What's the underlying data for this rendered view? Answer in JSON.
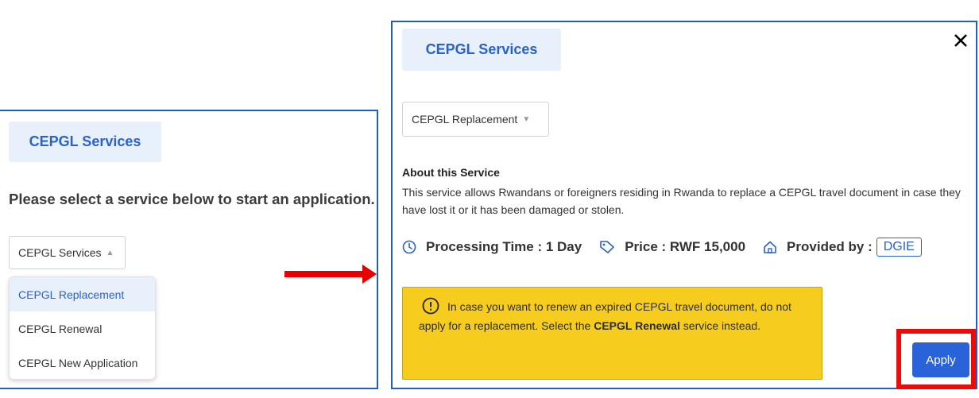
{
  "left_panel": {
    "tag": "CEPGL Services",
    "instruction": "Please select a service below to start an application.",
    "select_value": "CEPGL Services",
    "dropdown_options": [
      "CEPGL Replacement",
      "CEPGL Renewal",
      "CEPGL New Application"
    ],
    "active_option": "CEPGL Replacement"
  },
  "right_panel": {
    "tag": "CEPGL Services",
    "close_symbol": "✕",
    "select_value": "CEPGL Replacement",
    "about_title": "About this Service",
    "about_desc": "This service allows Rwandans or foreigners residing in Rwanda to replace a CEPGL travel document in case they have lost it or it has been damaged or stolen.",
    "processing_time": "Processing Time : 1 Day",
    "price": "Price : RWF 15,000",
    "provided_by_label": "Provided by :",
    "provided_by_value": "DGIE",
    "alert": {
      "text_start": "In case you want to renew an expired CEPGL travel document, do not apply for a replacement. Select the ",
      "text_bold": "CEPGL Renewal",
      "text_end": " service instead."
    },
    "apply_label": "Apply"
  },
  "colors": {
    "accent_blue": "#2a62c9",
    "panel_border": "#1f5fbf",
    "alert_yellow": "#f6cd1e",
    "highlight_red": "#ea0b0b",
    "arrow_red": "#e60000"
  },
  "icons": [
    "clock-icon",
    "price-tag-icon",
    "home-icon",
    "alert-circle-icon",
    "caret-up-icon",
    "caret-down-icon",
    "close-icon",
    "arrow-right-icon"
  ]
}
